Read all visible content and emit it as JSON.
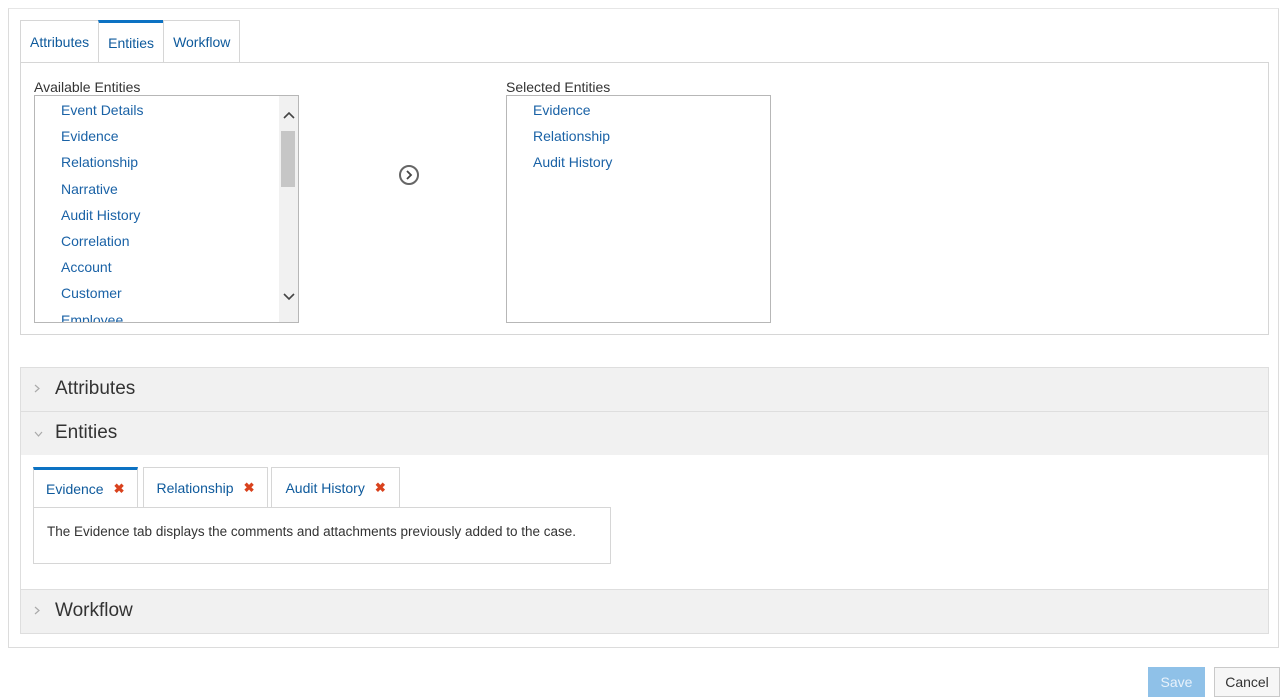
{
  "top_tabs": [
    "Attributes",
    "Entities",
    "Workflow"
  ],
  "available": {
    "label": "Available Entities",
    "items": [
      "Event Details",
      "Evidence",
      "Relationship",
      "Narrative",
      "Audit History",
      "Correlation",
      "Account",
      "Customer",
      "Employee"
    ]
  },
  "selected": {
    "label": "Selected Entities",
    "items": [
      "Evidence",
      "Relationship",
      "Audit History"
    ]
  },
  "move_icon": "chevron-right-circle-icon",
  "accordion": {
    "attributes": "Attributes",
    "entities": "Entities",
    "workflow": "Workflow"
  },
  "entity_tabs": [
    {
      "label": "Evidence",
      "remove_icon": "close-icon"
    },
    {
      "label": "Relationship",
      "remove_icon": "close-icon"
    },
    {
      "label": "Audit History",
      "remove_icon": "close-icon"
    }
  ],
  "entity_description": "The Evidence tab displays the comments and attachments previously added to the case.",
  "buttons": {
    "save": "Save",
    "cancel": "Cancel"
  },
  "colors": {
    "accent": "#0c72c3",
    "link": "#1a62a6",
    "remove": "#d9421d",
    "save_disabled": "#8fc1e8"
  }
}
